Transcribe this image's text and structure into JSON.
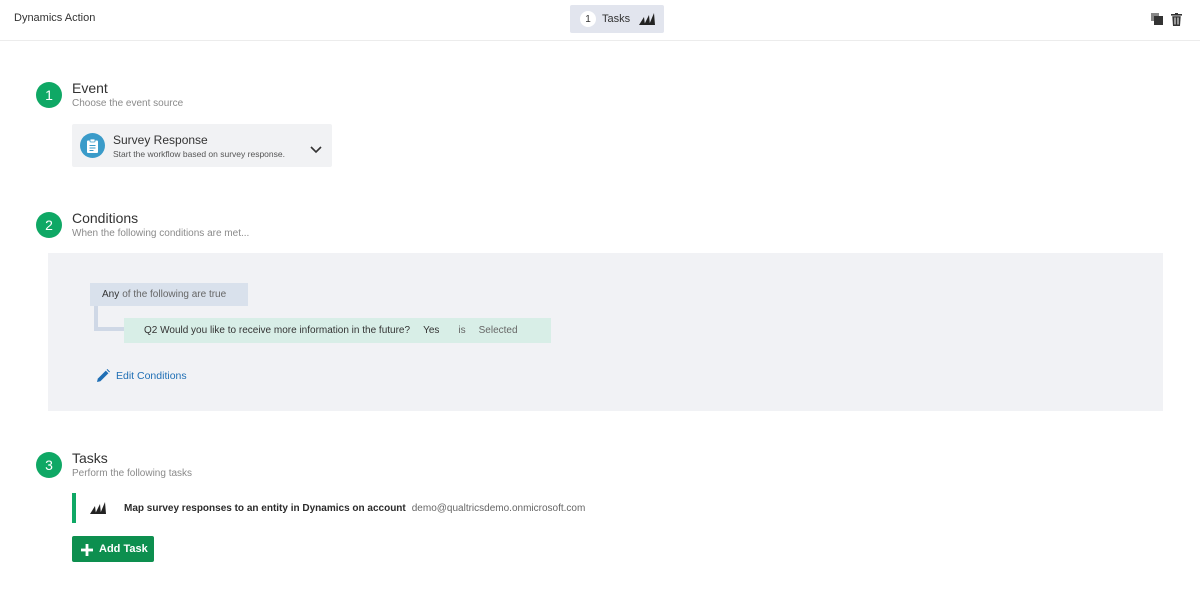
{
  "header": {
    "title": "Dynamics Action",
    "tasks_count": "1",
    "tasks_label": "Tasks",
    "icons": [
      "dynamics-logo-icon",
      "copy-icon",
      "trash-icon"
    ]
  },
  "steps": {
    "event": {
      "number": "1",
      "title": "Event",
      "subtitle": "Choose the event source",
      "selected": {
        "title": "Survey Response",
        "description": "Start the workflow based on survey response.",
        "icon": "clipboard-icon"
      }
    },
    "conditions": {
      "number": "2",
      "title": "Conditions",
      "subtitle": "When the following conditions are met...",
      "group": {
        "quantifier": "Any",
        "rest": "of the following are true"
      },
      "rule": {
        "question": "Q2 Would you like to receive more information in the future?",
        "answer": "Yes",
        "operator": "is",
        "value": "Selected"
      },
      "edit_label": "Edit Conditions"
    },
    "tasks": {
      "number": "3",
      "title": "Tasks",
      "subtitle": "Perform the following tasks",
      "items": [
        {
          "description": "Map survey responses to an entity in Dynamics on account",
          "account": "demo@qualtricsdemo.onmicrosoft.com"
        }
      ],
      "add_label": "Add Task"
    }
  },
  "colors": {
    "accent_green": "#0fa865",
    "button_green": "#0d8f4f",
    "link_blue": "#1f6fb5",
    "event_icon_blue": "#3a9bc9"
  }
}
